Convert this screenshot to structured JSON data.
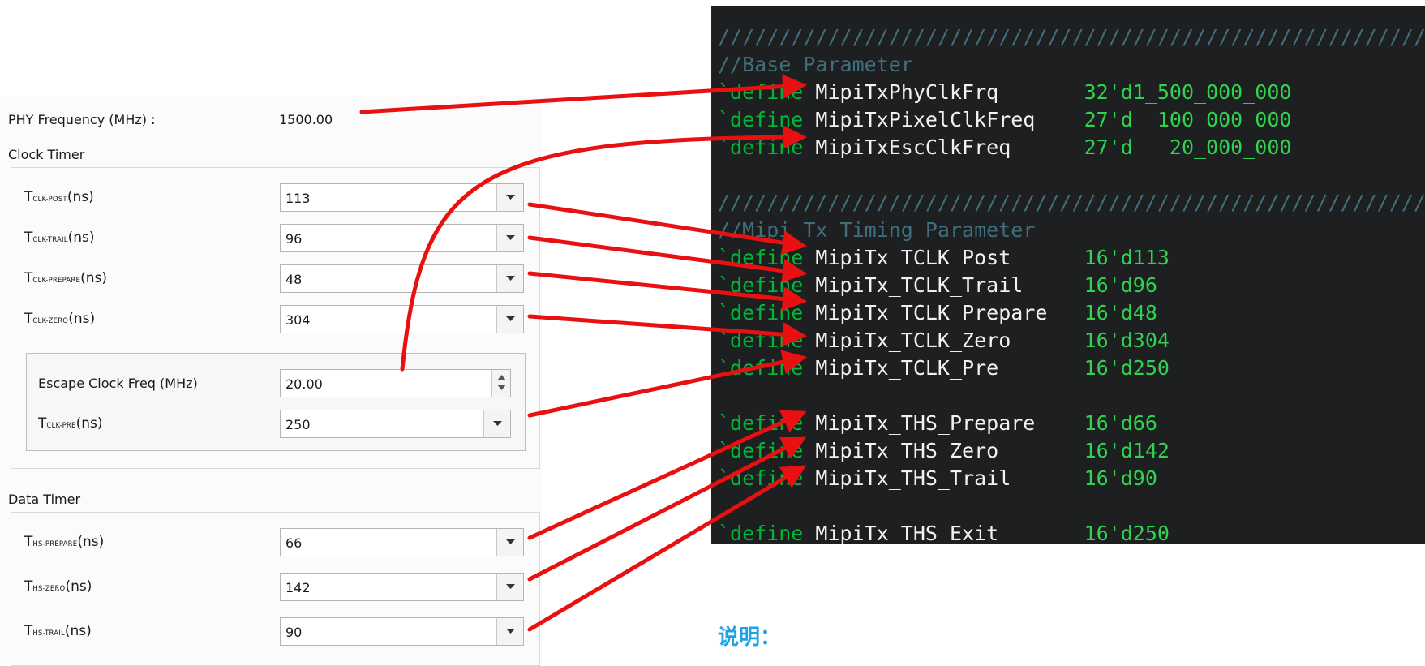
{
  "phy": {
    "label": "PHY Frequency (MHz) :",
    "value": "1500.00"
  },
  "clock_timer": {
    "title": "Clock Timer",
    "rows": [
      {
        "t": "T",
        "sub": "CLK-POST",
        "unit": "(ns)",
        "value": "113"
      },
      {
        "t": "T",
        "sub": "CLK-TRAIL",
        "unit": "(ns)",
        "value": "96"
      },
      {
        "t": "T",
        "sub": "CLK-PREPARE",
        "unit": "(ns)",
        "value": "48"
      },
      {
        "t": "T",
        "sub": "CLK-ZERO",
        "unit": "(ns)",
        "value": "304"
      }
    ],
    "escape_label": "Escape Clock Freq (MHz)",
    "escape_value": "20.00",
    "pre": {
      "t": "T",
      "sub": "CLK-PRE",
      "unit": "(ns)",
      "value": "250"
    }
  },
  "data_timer": {
    "title": "Data Timer",
    "rows": [
      {
        "t": "T",
        "sub": "HS-PREPARE",
        "unit": "(ns)",
        "value": "66"
      },
      {
        "t": "T",
        "sub": "HS-ZERO",
        "unit": "(ns)",
        "value": "142"
      },
      {
        "t": "T",
        "sub": "HS-TRAIL",
        "unit": "(ns)",
        "value": "90"
      }
    ]
  },
  "code": {
    "lines": [
      {
        "c": "//////////////////////////////////////////////////////////////"
      },
      {
        "c": "//Base Parameter"
      },
      {
        "k": "`define ",
        "i": "MipiTxPhyClkFrq       ",
        "n": "32'd1_500_000_000"
      },
      {
        "k": "`define ",
        "i": "MipiTxPixelClkFreq    ",
        "n": "27'd  100_000_000"
      },
      {
        "k": "`define ",
        "i": "MipiTxEscClkFreq      ",
        "n": "27'd   20_000_000"
      },
      {},
      {
        "c": "//////////////////////////////////////////////////////////////"
      },
      {
        "c": "//Mipi Tx Timing Parameter"
      },
      {
        "k": "`define ",
        "i": "MipiTx_TCLK_Post      ",
        "n": "16'd113"
      },
      {
        "k": "`define ",
        "i": "MipiTx_TCLK_Trail     ",
        "n": "16'd96"
      },
      {
        "k": "`define ",
        "i": "MipiTx_TCLK_Prepare   ",
        "n": "16'd48"
      },
      {
        "k": "`define ",
        "i": "MipiTx_TCLK_Zero      ",
        "n": "16'd304"
      },
      {
        "k": "`define ",
        "i": "MipiTx_TCLK_Pre       ",
        "n": "16'd250"
      },
      {},
      {
        "k": "`define ",
        "i": "MipiTx_THS_Prepare    ",
        "n": "16'd66"
      },
      {
        "k": "`define ",
        "i": "MipiTx_THS_Zero       ",
        "n": "16'd142"
      },
      {
        "k": "`define ",
        "i": "MipiTx_THS_Trail      ",
        "n": "16'd90"
      },
      {},
      {
        "k": "`define ",
        "i": "MipiTx_THS_Exit       ",
        "n": "16'd250"
      }
    ]
  },
  "note": "说明：",
  "colors": {
    "arrow": "#e81010",
    "code_bg": "#1d1f21",
    "keyword": "#00b838",
    "number": "#2fd34f",
    "comment": "#3f6f7c",
    "note": "#1fa3e8"
  }
}
